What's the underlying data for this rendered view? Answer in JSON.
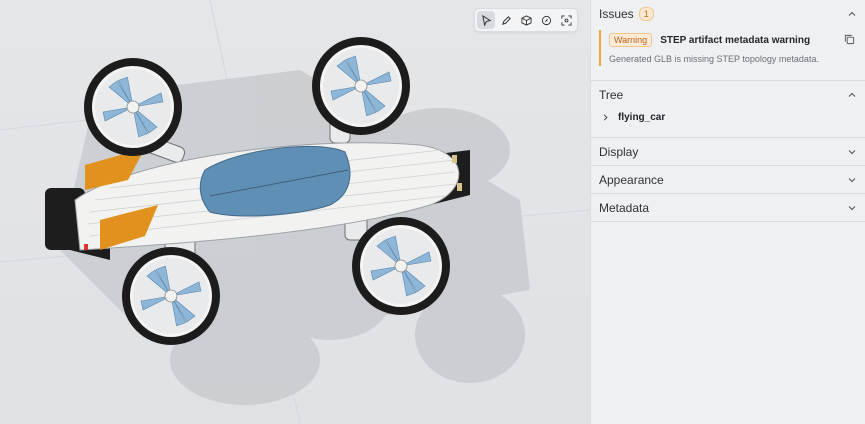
{
  "viewport": {
    "toolbar": {
      "tools": [
        {
          "name": "select-tool",
          "icon": "cursor-icon",
          "active": true
        },
        {
          "name": "annotate-tool",
          "icon": "pen-icon",
          "active": false
        },
        {
          "name": "cube-view-tool",
          "icon": "cube-icon",
          "active": false
        },
        {
          "name": "reset-view-tool",
          "icon": "compass-icon",
          "active": false
        },
        {
          "name": "fit-view-tool",
          "icon": "focus-icon",
          "active": false
        }
      ]
    },
    "model_colors": {
      "body": "#f2f2f0",
      "canopy": "#5f8fb4",
      "fins": "#e0911e",
      "rotor_blades": "#8db6d8",
      "tire": "#1c1c1c",
      "shadow": "#c9ccd0"
    }
  },
  "panel": {
    "issues": {
      "title": "Issues",
      "count": "1",
      "items": [
        {
          "tag": "Warning",
          "title": "STEP artifact metadata warning",
          "description": "Generated GLB is missing STEP topology metadata."
        }
      ]
    },
    "tree": {
      "title": "Tree",
      "root": "flying_car"
    },
    "display": {
      "title": "Display"
    },
    "appearance": {
      "title": "Appearance"
    },
    "metadata": {
      "title": "Metadata"
    }
  }
}
